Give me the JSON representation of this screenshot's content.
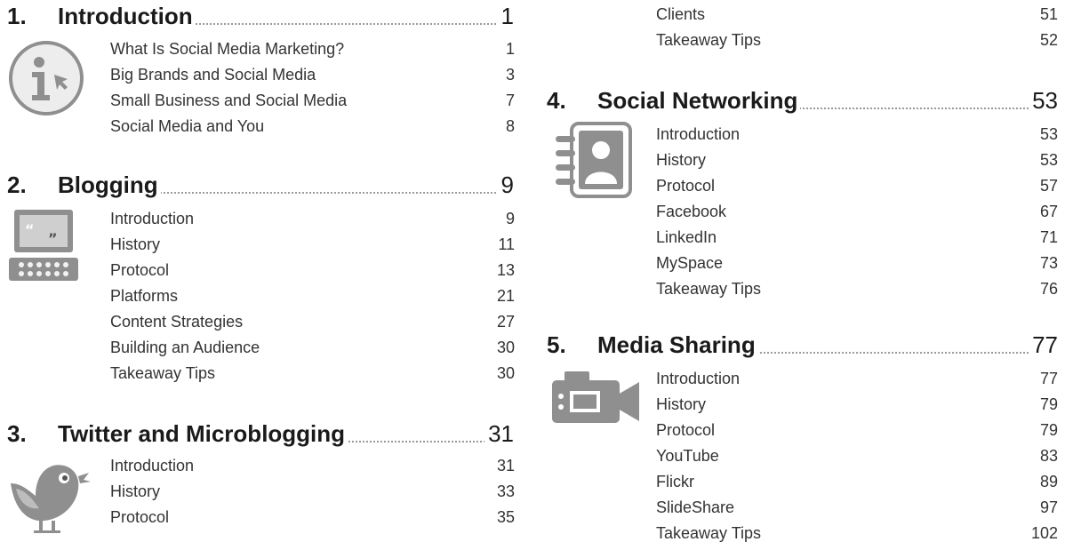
{
  "left_column": [
    {
      "number": "1.",
      "title": "Introduction",
      "page": "1",
      "icon": "info-icon",
      "entries": [
        {
          "title": "What Is Social Media Marketing?",
          "page": "1"
        },
        {
          "title": "Big Brands and Social Media",
          "page": "3"
        },
        {
          "title": "Small Business and Social Media",
          "page": "7"
        },
        {
          "title": "Social Media and You",
          "page": "8"
        }
      ]
    },
    {
      "number": "2.",
      "title": "Blogging",
      "page": "9",
      "icon": "laptop-quote-icon",
      "entries": [
        {
          "title": "Introduction",
          "page": "9"
        },
        {
          "title": "History",
          "page": "11"
        },
        {
          "title": "Protocol",
          "page": "13"
        },
        {
          "title": "Platforms",
          "page": "21"
        },
        {
          "title": "Content Strategies",
          "page": "27"
        },
        {
          "title": "Building an Audience",
          "page": "30"
        },
        {
          "title": "Takeaway Tips",
          "page": "30"
        }
      ]
    },
    {
      "number": "3.",
      "title": "Twitter and Microblogging",
      "page": "31",
      "icon": "bird-icon",
      "entries": [
        {
          "title": "Introduction",
          "page": "31"
        },
        {
          "title": "History",
          "page": "33"
        },
        {
          "title": "Protocol",
          "page": "35"
        }
      ]
    }
  ],
  "right_column": {
    "continued_entries": [
      {
        "title": "Clients",
        "page": "51"
      },
      {
        "title": "Takeaway Tips",
        "page": "52"
      }
    ],
    "chapters": [
      {
        "number": "4.",
        "title": "Social Networking",
        "page": "53",
        "icon": "address-book-icon",
        "entries": [
          {
            "title": "Introduction",
            "page": "53"
          },
          {
            "title": "History",
            "page": "53"
          },
          {
            "title": "Protocol",
            "page": "57"
          },
          {
            "title": "Facebook",
            "page": "67"
          },
          {
            "title": "LinkedIn",
            "page": "71"
          },
          {
            "title": "MySpace",
            "page": "73"
          },
          {
            "title": "Takeaway Tips",
            "page": "76"
          }
        ]
      },
      {
        "number": "5.",
        "title": "Media Sharing",
        "page": "77",
        "icon": "video-camera-icon",
        "entries": [
          {
            "title": "Introduction",
            "page": "77"
          },
          {
            "title": "History",
            "page": "79"
          },
          {
            "title": "Protocol",
            "page": "79"
          },
          {
            "title": "YouTube",
            "page": "83"
          },
          {
            "title": "Flickr",
            "page": "89"
          },
          {
            "title": "SlideShare",
            "page": "97"
          },
          {
            "title": "Takeaway Tips",
            "page": "102"
          }
        ]
      }
    ]
  }
}
